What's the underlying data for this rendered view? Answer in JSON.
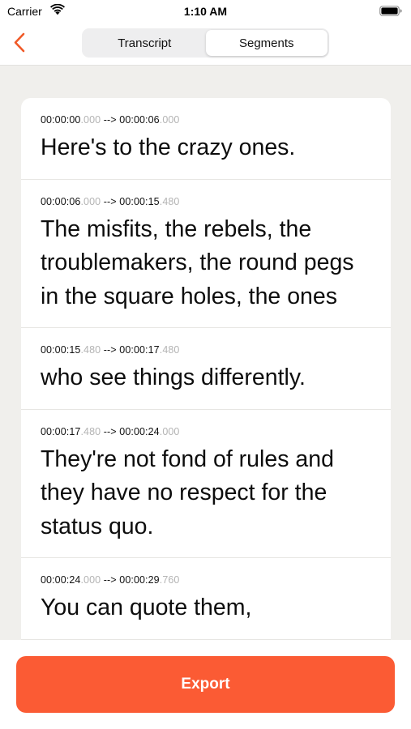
{
  "status_bar": {
    "carrier": "Carrier",
    "time": "1:10 AM",
    "wifi_icon": "wifi-icon",
    "battery_icon": "battery-icon"
  },
  "nav": {
    "back_icon": "chevron-left-icon",
    "tabs": [
      {
        "label": "Transcript",
        "active": false
      },
      {
        "label": "Segments",
        "active": true
      }
    ],
    "accent_color": "#f05a28"
  },
  "segments": [
    {
      "start_main": "00:00:00",
      "start_ms": ".000",
      "arrow": " --> ",
      "end_main": "00:00:06",
      "end_ms": ".000",
      "text": "Here's to the crazy ones."
    },
    {
      "start_main": "00:00:06",
      "start_ms": ".000",
      "arrow": " --> ",
      "end_main": "00:00:15",
      "end_ms": ".480",
      "text": "The misfits, the rebels, the troublemakers, the round pegs in the square holes, the ones"
    },
    {
      "start_main": "00:00:15",
      "start_ms": ".480",
      "arrow": " --> ",
      "end_main": "00:00:17",
      "end_ms": ".480",
      "text": "who see things differently."
    },
    {
      "start_main": "00:00:17",
      "start_ms": ".480",
      "arrow": " --> ",
      "end_main": "00:00:24",
      "end_ms": ".000",
      "text": "They're not fond of rules and they have no respect for the status quo."
    },
    {
      "start_main": "00:00:24",
      "start_ms": ".000",
      "arrow": " --> ",
      "end_main": "00:00:29",
      "end_ms": ".760",
      "text": "You can quote them,"
    }
  ],
  "footer": {
    "export_label": "Export",
    "export_color": "#fb5b34"
  }
}
